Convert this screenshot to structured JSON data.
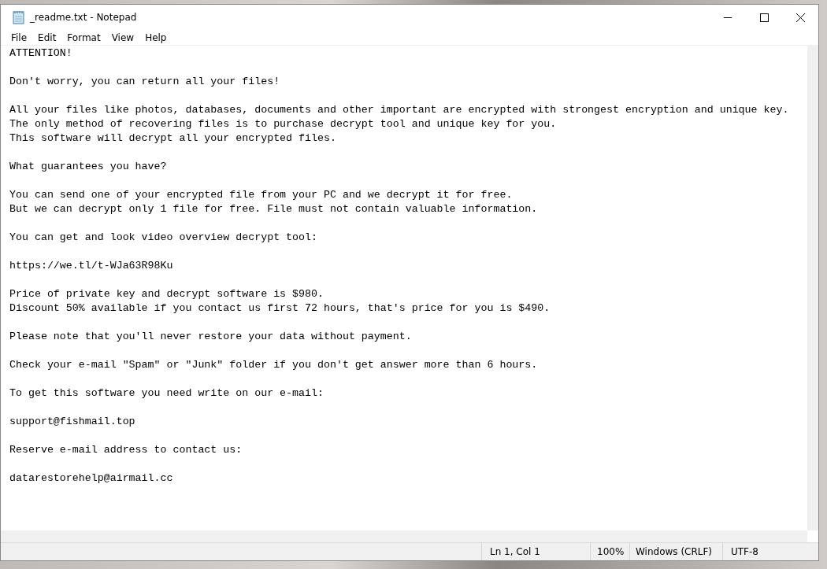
{
  "window": {
    "title": "_readme.txt - Notepad"
  },
  "menu": [
    "File",
    "Edit",
    "Format",
    "View",
    "Help"
  ],
  "document": {
    "paragraphs": [
      [
        "ATTENTION!"
      ],
      [
        "Don't worry, you can return all your files!"
      ],
      [
        "All your files like photos, databases, documents and other important are encrypted with strongest encryption and unique key.",
        "The only method of recovering files is to purchase decrypt tool and unique key for you.",
        "This software will decrypt all your encrypted files."
      ],
      [
        "What guarantees you have?"
      ],
      [
        "You can send one of your encrypted file from your PC and we decrypt it for free.",
        "But we can decrypt only 1 file for free. File must not contain valuable information."
      ],
      [
        "You can get and look video overview decrypt tool:"
      ],
      [
        "https://we.tl/t-WJa63R98Ku"
      ],
      [
        "Price of private key and decrypt software is $980.",
        "Discount 50% available if you contact us first 72 hours, that's price for you is $490."
      ],
      [
        "Please note that you'll never restore your data without payment."
      ],
      [
        "Check your e-mail \"Spam\" or \"Junk\" folder if you don't get answer more than 6 hours."
      ],
      [
        "To get this software you need write on our e-mail:"
      ],
      [
        "support@fishmail.top"
      ],
      [
        "Reserve e-mail address to contact us:"
      ],
      [
        "datarestorehelp@airmail.cc"
      ]
    ]
  },
  "status_bar": {
    "position": "Ln 1, Col 1",
    "zoom": "100%",
    "line_ending": "Windows (CRLF)",
    "encoding": "UTF-8"
  }
}
